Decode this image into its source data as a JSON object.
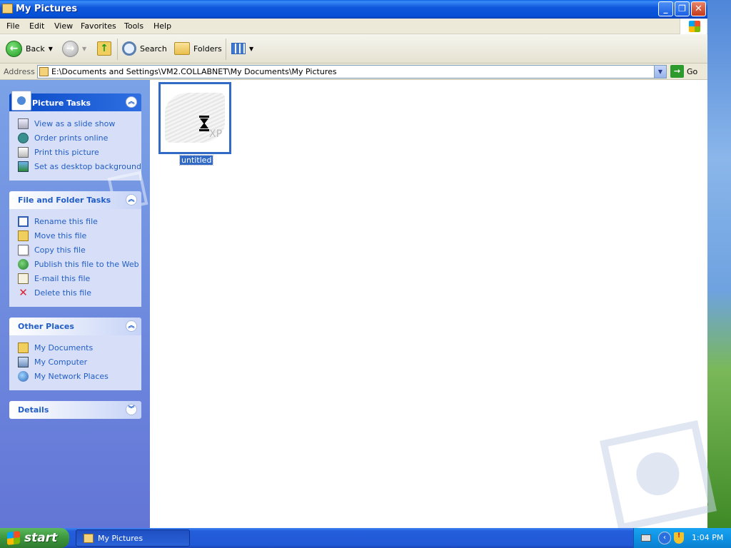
{
  "window": {
    "title": "My Pictures",
    "buttons": {
      "minimize": "_",
      "maximize": "❐",
      "close": "✕"
    }
  },
  "menubar": {
    "items": [
      "File",
      "Edit",
      "View",
      "Favorites",
      "Tools",
      "Help"
    ]
  },
  "toolbar": {
    "back_label": "Back",
    "search_label": "Search",
    "folders_label": "Folders",
    "icons": [
      "back-icon",
      "forward-icon",
      "up-folder-icon",
      "search-icon",
      "folders-icon",
      "views-icon"
    ]
  },
  "address": {
    "label": "Address",
    "value": "E:\\Documents and Settings\\VM2.COLLABNET\\My Documents\\My Pictures",
    "go_label": "Go"
  },
  "sidebar": {
    "picture_tasks": {
      "title": "Picture Tasks",
      "items": [
        "View as a slide show",
        "Order prints online",
        "Print this picture",
        "Set as desktop background"
      ]
    },
    "file_folder_tasks": {
      "title": "File and Folder Tasks",
      "items": [
        "Rename this file",
        "Move this file",
        "Copy this file",
        "Publish this file to the Web",
        "E-mail this file",
        "Delete this file"
      ]
    },
    "other_places": {
      "title": "Other Places",
      "items": [
        "My Documents",
        "My Computer",
        "My Network Places"
      ]
    },
    "details": {
      "title": "Details"
    }
  },
  "content": {
    "files": [
      {
        "name": "untitled",
        "selected": true
      }
    ]
  },
  "taskbar": {
    "start_label": "start",
    "task_label": "My Pictures",
    "clock": "1:04 PM"
  },
  "colors": {
    "titlebar": "#0a5fe0",
    "selection": "#316ac5",
    "link": "#215dc6",
    "sidebar": "#7ba2e7"
  }
}
